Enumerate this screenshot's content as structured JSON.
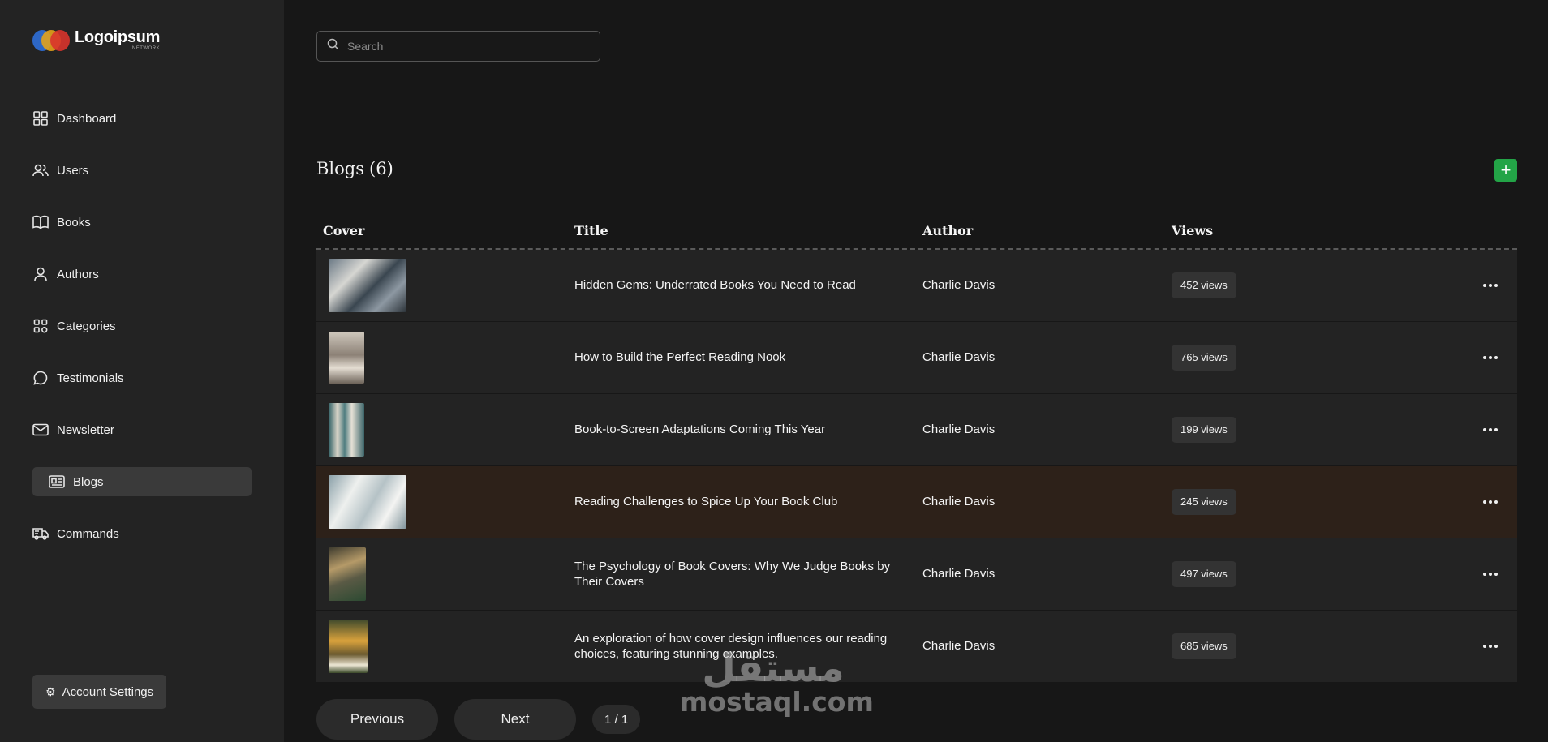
{
  "brand": {
    "name": "Logoipsum",
    "tagline": "NETWORK",
    "colors": [
      "#2f6fd8",
      "#e3a21a",
      "#d8342c"
    ]
  },
  "sidebar": {
    "items": [
      {
        "label": "Dashboard",
        "icon": "dashboard-icon"
      },
      {
        "label": "Users",
        "icon": "users-icon"
      },
      {
        "label": "Books",
        "icon": "book-icon"
      },
      {
        "label": "Authors",
        "icon": "user-icon"
      },
      {
        "label": "Categories",
        "icon": "categories-icon"
      },
      {
        "label": "Testimonials",
        "icon": "chat-icon"
      },
      {
        "label": "Newsletter",
        "icon": "mail-icon"
      },
      {
        "label": "Blogs",
        "icon": "blog-icon",
        "active": true
      },
      {
        "label": "Commands",
        "icon": "truck-icon"
      }
    ],
    "account_label": "Account Settings"
  },
  "search": {
    "placeholder": "Search",
    "value": ""
  },
  "header": {
    "title": "Blogs",
    "count": "(6)",
    "add_label": "+"
  },
  "accent": "#23a447",
  "table": {
    "columns": {
      "cover": "Cover",
      "title": "Title",
      "author": "Author",
      "views": "Views"
    },
    "rows": [
      {
        "title": "Hidden Gems: Underrated Books You Need to Read",
        "author": "Charlie Davis",
        "views": "452 views"
      },
      {
        "title": "How to Build the Perfect Reading Nook",
        "author": "Charlie Davis",
        "views": "765 views"
      },
      {
        "title": "Book-to-Screen Adaptations Coming This Year",
        "author": "Charlie Davis",
        "views": "199 views"
      },
      {
        "title": "Reading Challenges to Spice Up Your Book Club",
        "author": "Charlie Davis",
        "views": "245 views"
      },
      {
        "title": "The Psychology of Book Covers: Why We Judge Books by Their Covers",
        "author": "Charlie Davis",
        "views": "497 views"
      },
      {
        "title": "An exploration of how cover design influences our reading choices, featuring stunning examples.",
        "author": "Charlie Davis",
        "views": "685 views"
      }
    ]
  },
  "pagination": {
    "previous": "Previous",
    "next": "Next",
    "page": "1 / 1"
  },
  "watermark": {
    "arabic": "مستقل",
    "latin": "mostaql.com"
  }
}
